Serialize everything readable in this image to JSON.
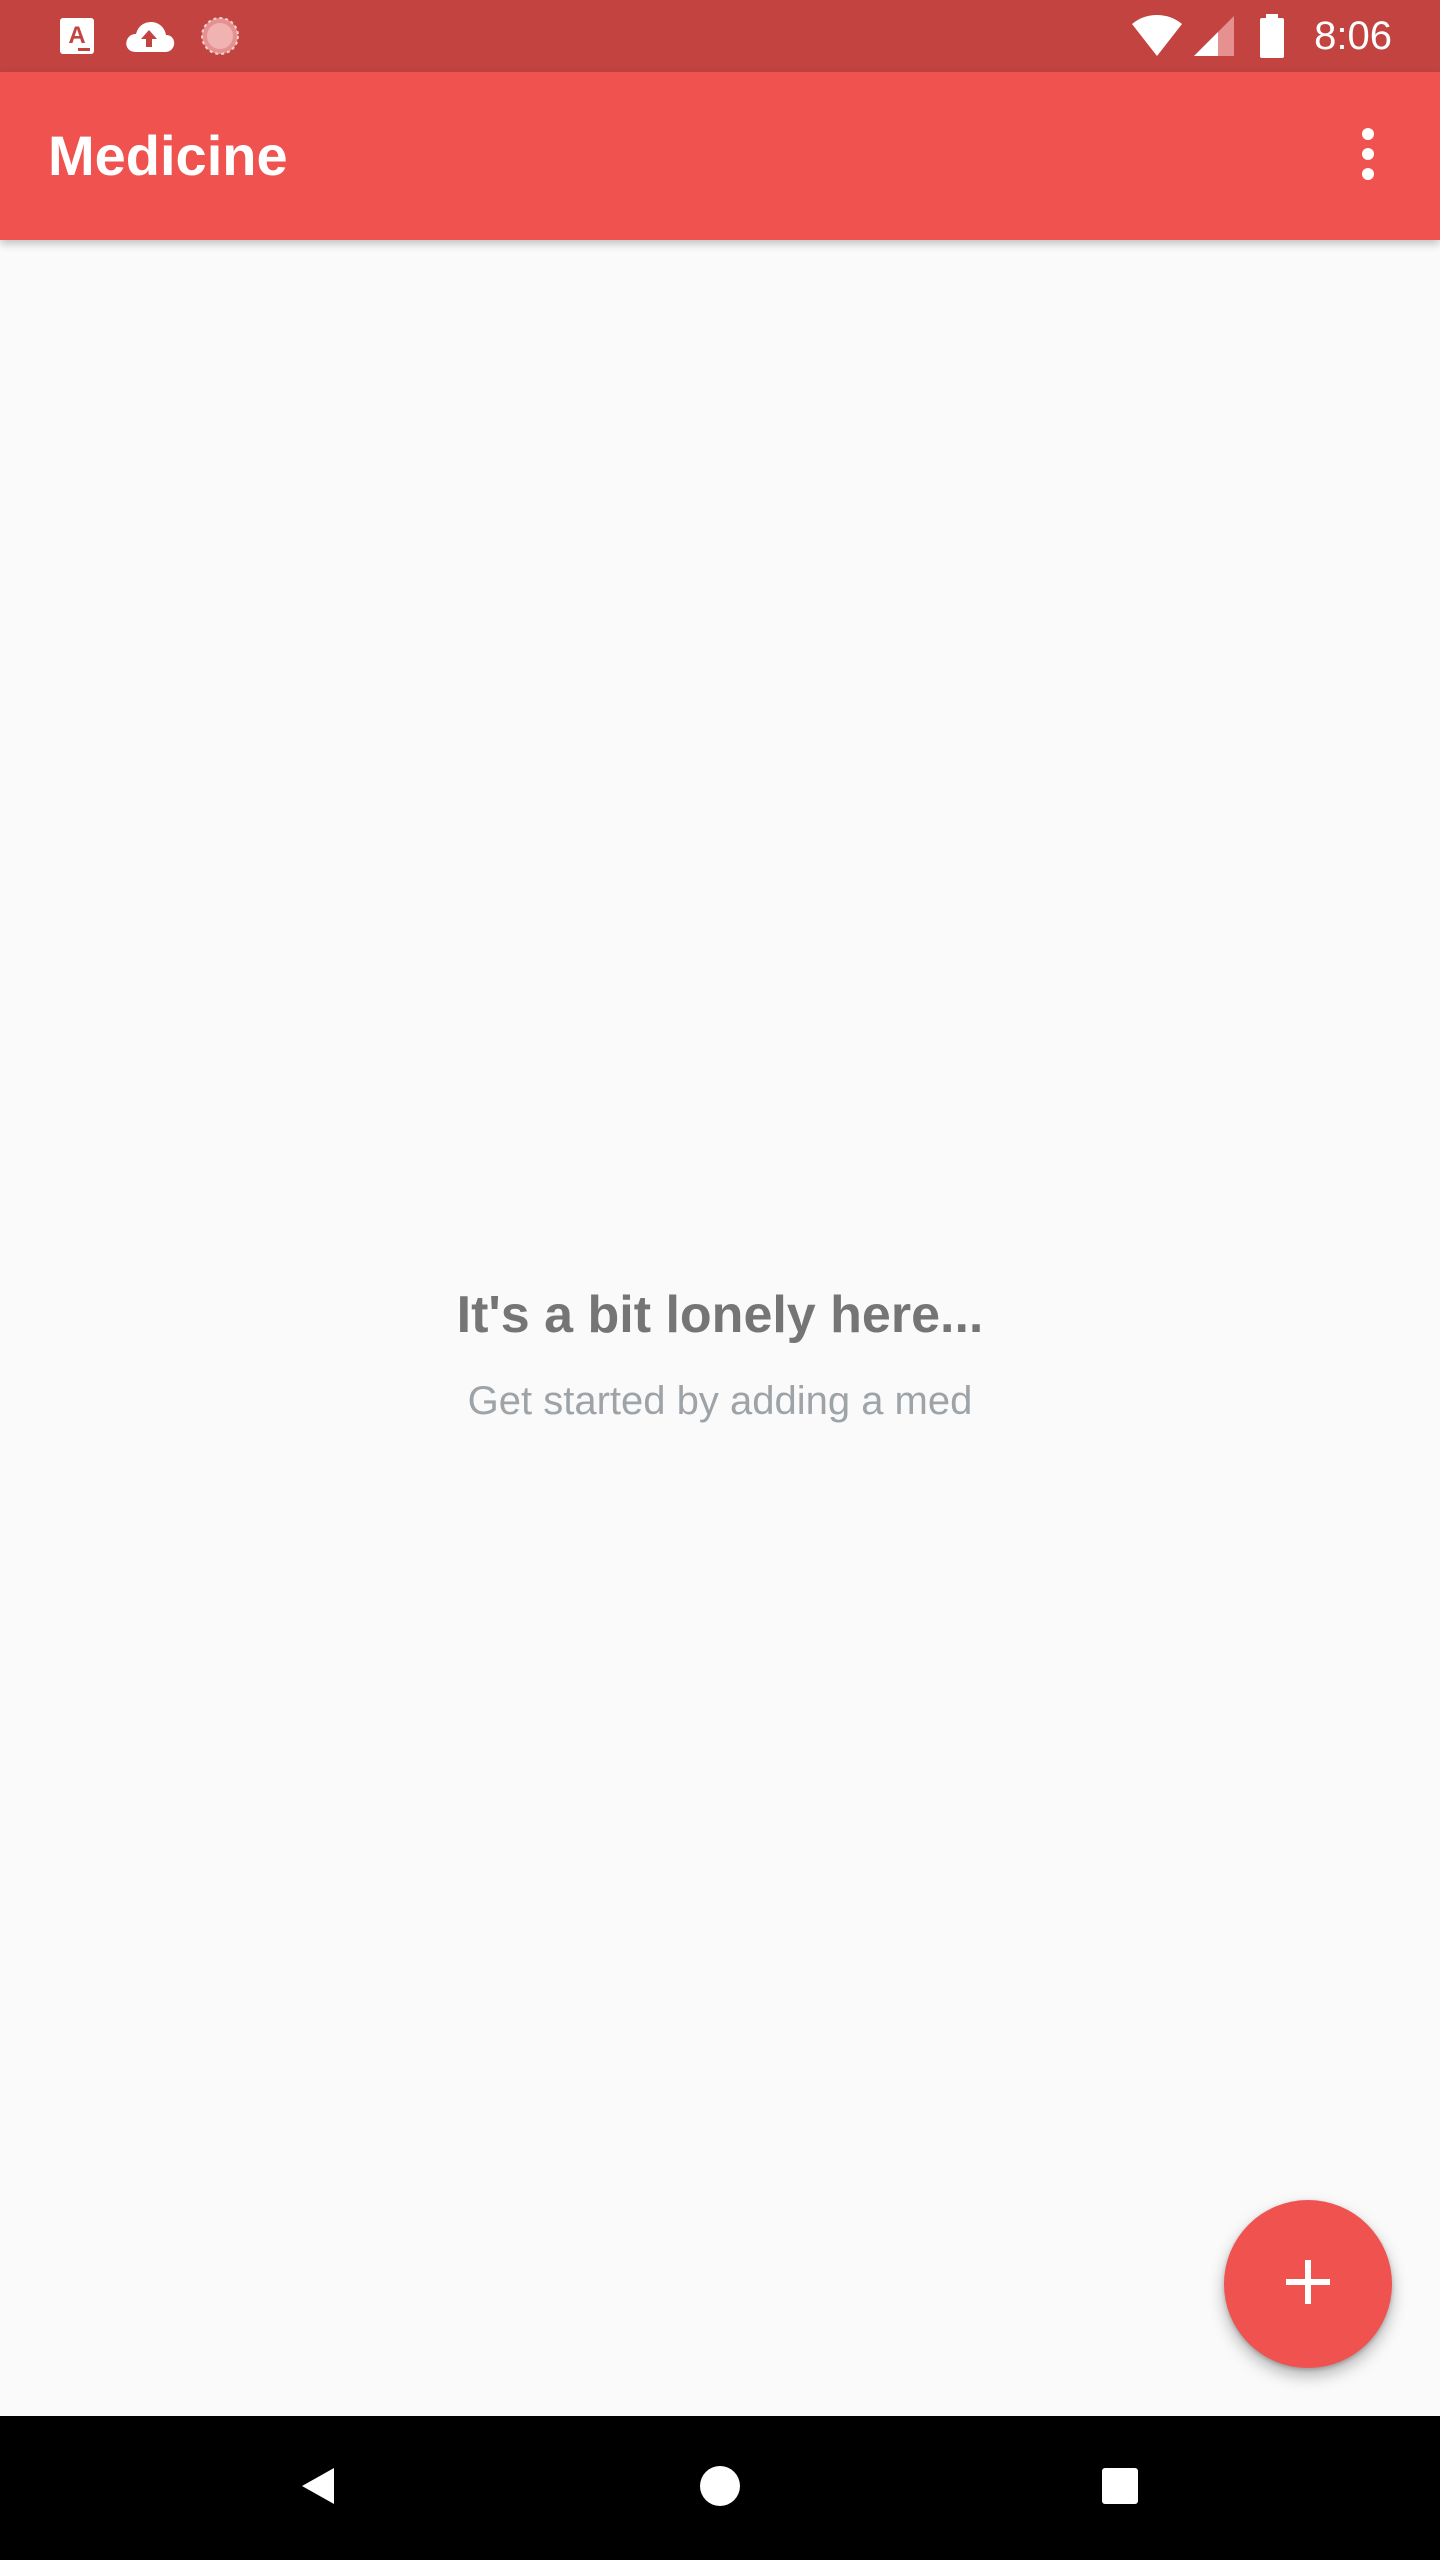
{
  "status_bar": {
    "time": "8:06",
    "icons": [
      "a-letter-notification-icon",
      "cloud-upload-icon",
      "sync-spinner-icon",
      "wifi-icon",
      "cell-signal-icon",
      "battery-icon"
    ]
  },
  "app_bar": {
    "title": "Medicine",
    "menu_icon": "more-vert-icon"
  },
  "empty_state": {
    "title": "It's a bit lonely here...",
    "subtitle": "Get started by adding a med"
  },
  "fab": {
    "icon": "plus-icon"
  },
  "nav_bar": {
    "buttons": [
      "back-icon",
      "home-icon",
      "recents-icon"
    ]
  },
  "colors": {
    "primary": "#f0524f",
    "primary_dark": "#c24340",
    "background": "#fafafa",
    "empty_title": "#757575",
    "empty_subtitle": "#9ea3a8"
  }
}
